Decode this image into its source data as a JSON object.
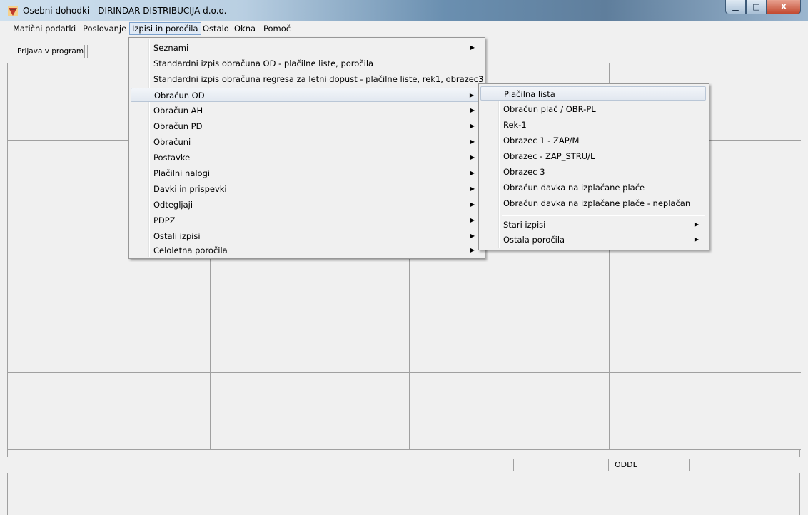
{
  "window": {
    "title": "Osebni dohodki - DIRINDAR DISTRIBUCIJA d.o.o.",
    "minimize_glyph": "▁",
    "maximize_glyph": "□",
    "close_glyph": "X"
  },
  "menubar": {
    "items": [
      "Matični podatki",
      "Poslovanje",
      "Izpisi in poročila",
      "Ostalo",
      "Okna",
      "Pomoč"
    ],
    "active_index": 2
  },
  "toolbar": {
    "login_label": "Prijava v program"
  },
  "izpisi_menu": {
    "items": [
      {
        "label": "Seznami",
        "submenu": true
      },
      {
        "label": "Standardni izpis obračuna OD - plačilne liste, poročila",
        "submenu": false
      },
      {
        "label": "Standardni izpis obračuna regresa za letni dopust - plačilne liste, rek1, obrazec3",
        "submenu": false
      },
      {
        "label": "Obračun OD",
        "submenu": true,
        "highlighted": true
      },
      {
        "label": "Obračun AH",
        "submenu": true
      },
      {
        "label": "Obračun PD",
        "submenu": true
      },
      {
        "label": "Obračuni",
        "submenu": true
      },
      {
        "label": "Postavke",
        "submenu": true
      },
      {
        "label": "Plačilni nalogi",
        "submenu": true
      },
      {
        "label": "Davki in prispevki",
        "submenu": true
      },
      {
        "label": "Odtegljaji",
        "submenu": true
      },
      {
        "label": "PDPZ",
        "submenu": true
      },
      {
        "label": "Ostali izpisi",
        "submenu": true
      },
      {
        "label": "Celoletna poročila",
        "submenu": true
      }
    ]
  },
  "obracun_od_submenu": {
    "items": [
      {
        "label": "Plačilna lista",
        "submenu": false,
        "highlighted": true
      },
      {
        "label": "Obračun plač / OBR-PL",
        "submenu": false
      },
      {
        "label": "Rek-1",
        "submenu": false
      },
      {
        "label": "Obrazec 1 - ZAP/M",
        "submenu": false
      },
      {
        "label": "Obrazec - ZAP_STRU/L",
        "submenu": false
      },
      {
        "label": "Obrazec 3",
        "submenu": false
      },
      {
        "label": "Obračun davka na izplačane plače",
        "submenu": false
      },
      {
        "label": "Obračun davka na izplačane plače - neplačan",
        "submenu": false
      },
      {
        "label": "Stari izpisi",
        "submenu": true
      },
      {
        "label": "Ostala poročila",
        "submenu": true
      }
    ]
  },
  "statusbar": {
    "panels": [
      "",
      "",
      "ODDL",
      ""
    ]
  },
  "colors": {
    "menu_text": "#000000",
    "highlight_border": "#b9c6d6"
  }
}
